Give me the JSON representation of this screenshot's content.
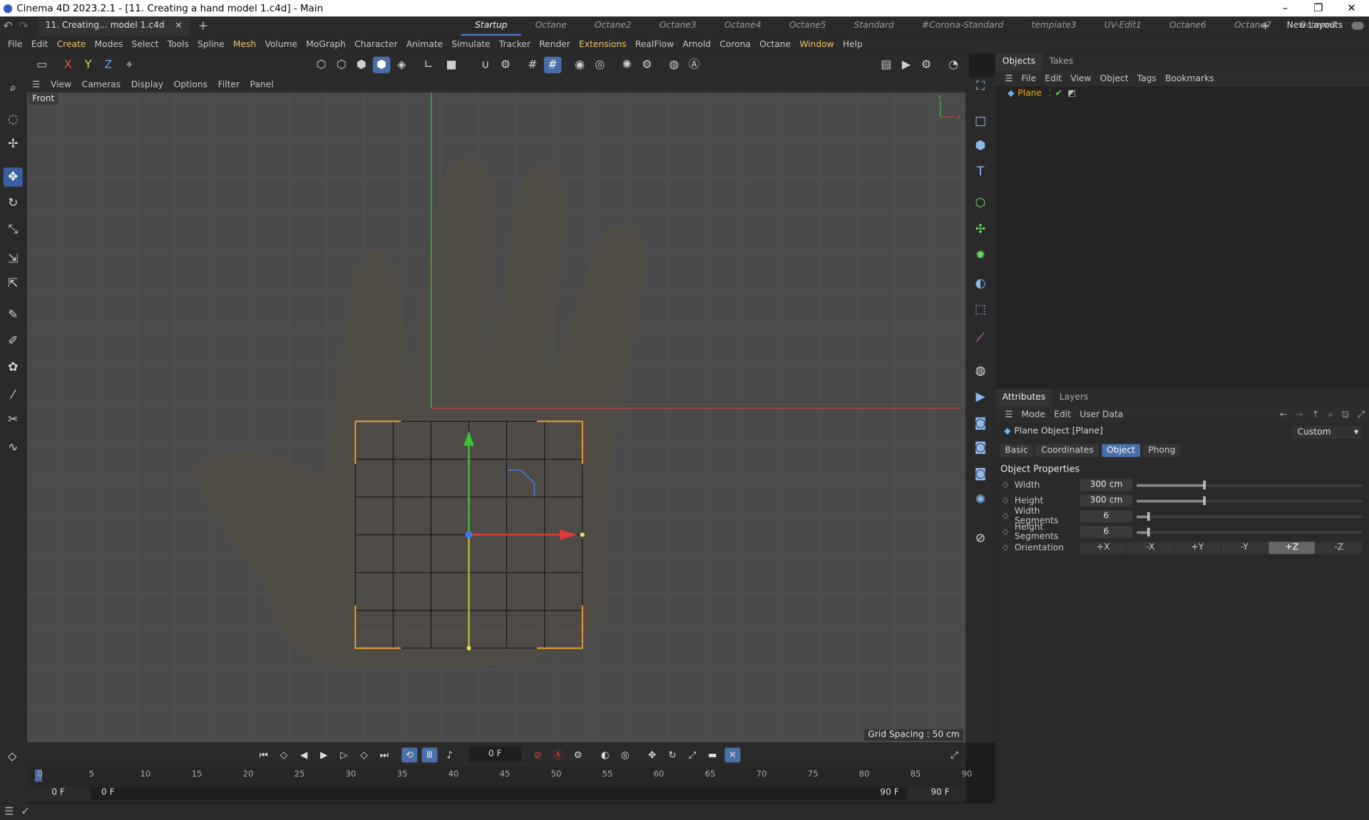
{
  "window": {
    "title": "Cinema 4D 2023.2.1 - [11. Creating a hand model 1.c4d] - Main"
  },
  "doc_tab": {
    "label": "11. Creating... model 1.c4d",
    "close": "×"
  },
  "layouts": {
    "items": [
      "Startup",
      "Octane",
      "Octane2",
      "Octane3",
      "Octane4",
      "Octane5",
      "Standard",
      "#Corona-Standard",
      "template3",
      "UV-Edit1",
      "Octane6",
      "Octane7",
      "Octane8"
    ],
    "active": "Startup",
    "new_layouts": "New Layouts"
  },
  "menu": [
    "File",
    "Edit",
    "Create",
    "Modes",
    "Select",
    "Tools",
    "Spline",
    "Mesh",
    "Volume",
    "MoGraph",
    "Character",
    "Animate",
    "Simulate",
    "Tracker",
    "Render",
    "Extensions",
    "RealFlow",
    "Arnold",
    "Corona",
    "Octane",
    "Window",
    "Help"
  ],
  "toolbar": {
    "x": "X",
    "y": "Y",
    "z": "Z"
  },
  "viewport_menu": [
    "View",
    "Cameras",
    "Display",
    "Options",
    "Filter",
    "Panel"
  ],
  "viewport": {
    "label": "Front",
    "grid_spacing": "Grid Spacing : 50 cm",
    "axis_y": "Y",
    "axis_x": "X"
  },
  "objects_panel": {
    "tabs": [
      "Objects",
      "Takes"
    ],
    "menu": [
      "File",
      "Edit",
      "View",
      "Object",
      "Tags",
      "Bookmarks"
    ],
    "object_name": "Plane"
  },
  "attributes": {
    "tabs": [
      "Attributes",
      "Layers"
    ],
    "menu": [
      "Mode",
      "Edit",
      "User Data"
    ],
    "object_title": "Plane Object [Plane]",
    "preset": "Custom",
    "subtabs": [
      "Basic",
      "Coordinates",
      "Object",
      "Phong"
    ],
    "active_subtab": "Object",
    "section": "Object Properties",
    "props": [
      {
        "label": "Width",
        "value": "300 cm",
        "fraction": 0.3
      },
      {
        "label": "Height",
        "value": "300 cm",
        "fraction": 0.3
      },
      {
        "label": "Width Segments",
        "value": "6",
        "fraction": 0.05
      },
      {
        "label": "Height Segments",
        "value": "6",
        "fraction": 0.05
      }
    ],
    "orientation_label": "Orientation",
    "orientation": [
      "+X",
      "-X",
      "+Y",
      "-Y",
      "+Z",
      "-Z"
    ],
    "orientation_active": "+Z"
  },
  "timeline": {
    "current_frame": "0 F",
    "ticks": [
      "0",
      "5",
      "10",
      "15",
      "20",
      "25",
      "30",
      "35",
      "40",
      "45",
      "50",
      "55",
      "60",
      "65",
      "70",
      "75",
      "80",
      "85",
      "90"
    ],
    "start": "0 F",
    "preview_start": "0 F",
    "preview_end": "90 F",
    "end": "90 F"
  },
  "colors": {
    "accent": "#4a6ea8",
    "object_orange": "#f0b000",
    "axis_red": "#e03a3a",
    "axis_green": "#3ac43a",
    "axis_blue": "#3a7ae0",
    "selection": "#f2a531"
  }
}
